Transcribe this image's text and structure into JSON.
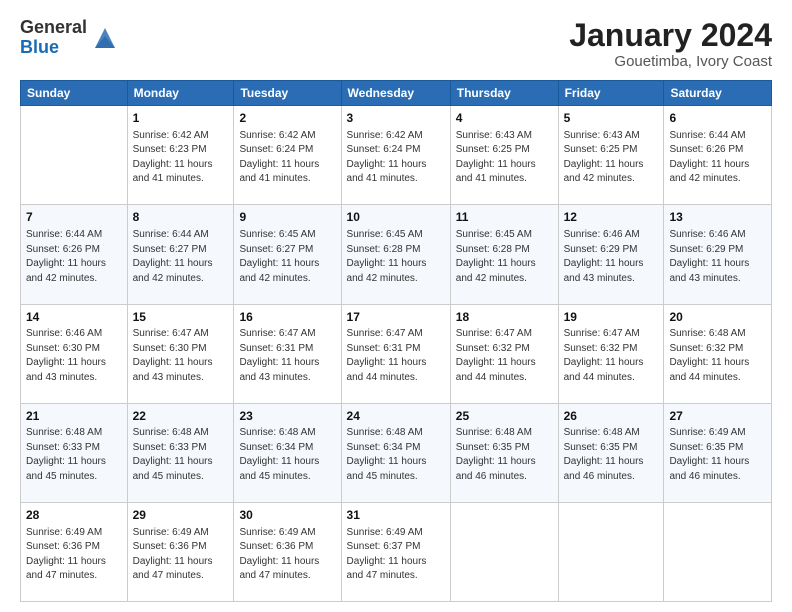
{
  "header": {
    "logo_general": "General",
    "logo_blue": "Blue",
    "title": "January 2024",
    "subtitle": "Gouetimba, Ivory Coast"
  },
  "days_of_week": [
    "Sunday",
    "Monday",
    "Tuesday",
    "Wednesday",
    "Thursday",
    "Friday",
    "Saturday"
  ],
  "weeks": [
    [
      {
        "day": "",
        "info": ""
      },
      {
        "day": "1",
        "info": "Sunrise: 6:42 AM\nSunset: 6:23 PM\nDaylight: 11 hours\nand 41 minutes."
      },
      {
        "day": "2",
        "info": "Sunrise: 6:42 AM\nSunset: 6:24 PM\nDaylight: 11 hours\nand 41 minutes."
      },
      {
        "day": "3",
        "info": "Sunrise: 6:42 AM\nSunset: 6:24 PM\nDaylight: 11 hours\nand 41 minutes."
      },
      {
        "day": "4",
        "info": "Sunrise: 6:43 AM\nSunset: 6:25 PM\nDaylight: 11 hours\nand 41 minutes."
      },
      {
        "day": "5",
        "info": "Sunrise: 6:43 AM\nSunset: 6:25 PM\nDaylight: 11 hours\nand 42 minutes."
      },
      {
        "day": "6",
        "info": "Sunrise: 6:44 AM\nSunset: 6:26 PM\nDaylight: 11 hours\nand 42 minutes."
      }
    ],
    [
      {
        "day": "7",
        "info": "Sunrise: 6:44 AM\nSunset: 6:26 PM\nDaylight: 11 hours\nand 42 minutes."
      },
      {
        "day": "8",
        "info": "Sunrise: 6:44 AM\nSunset: 6:27 PM\nDaylight: 11 hours\nand 42 minutes."
      },
      {
        "day": "9",
        "info": "Sunrise: 6:45 AM\nSunset: 6:27 PM\nDaylight: 11 hours\nand 42 minutes."
      },
      {
        "day": "10",
        "info": "Sunrise: 6:45 AM\nSunset: 6:28 PM\nDaylight: 11 hours\nand 42 minutes."
      },
      {
        "day": "11",
        "info": "Sunrise: 6:45 AM\nSunset: 6:28 PM\nDaylight: 11 hours\nand 42 minutes."
      },
      {
        "day": "12",
        "info": "Sunrise: 6:46 AM\nSunset: 6:29 PM\nDaylight: 11 hours\nand 43 minutes."
      },
      {
        "day": "13",
        "info": "Sunrise: 6:46 AM\nSunset: 6:29 PM\nDaylight: 11 hours\nand 43 minutes."
      }
    ],
    [
      {
        "day": "14",
        "info": "Sunrise: 6:46 AM\nSunset: 6:30 PM\nDaylight: 11 hours\nand 43 minutes."
      },
      {
        "day": "15",
        "info": "Sunrise: 6:47 AM\nSunset: 6:30 PM\nDaylight: 11 hours\nand 43 minutes."
      },
      {
        "day": "16",
        "info": "Sunrise: 6:47 AM\nSunset: 6:31 PM\nDaylight: 11 hours\nand 43 minutes."
      },
      {
        "day": "17",
        "info": "Sunrise: 6:47 AM\nSunset: 6:31 PM\nDaylight: 11 hours\nand 44 minutes."
      },
      {
        "day": "18",
        "info": "Sunrise: 6:47 AM\nSunset: 6:32 PM\nDaylight: 11 hours\nand 44 minutes."
      },
      {
        "day": "19",
        "info": "Sunrise: 6:47 AM\nSunset: 6:32 PM\nDaylight: 11 hours\nand 44 minutes."
      },
      {
        "day": "20",
        "info": "Sunrise: 6:48 AM\nSunset: 6:32 PM\nDaylight: 11 hours\nand 44 minutes."
      }
    ],
    [
      {
        "day": "21",
        "info": "Sunrise: 6:48 AM\nSunset: 6:33 PM\nDaylight: 11 hours\nand 45 minutes."
      },
      {
        "day": "22",
        "info": "Sunrise: 6:48 AM\nSunset: 6:33 PM\nDaylight: 11 hours\nand 45 minutes."
      },
      {
        "day": "23",
        "info": "Sunrise: 6:48 AM\nSunset: 6:34 PM\nDaylight: 11 hours\nand 45 minutes."
      },
      {
        "day": "24",
        "info": "Sunrise: 6:48 AM\nSunset: 6:34 PM\nDaylight: 11 hours\nand 45 minutes."
      },
      {
        "day": "25",
        "info": "Sunrise: 6:48 AM\nSunset: 6:35 PM\nDaylight: 11 hours\nand 46 minutes."
      },
      {
        "day": "26",
        "info": "Sunrise: 6:48 AM\nSunset: 6:35 PM\nDaylight: 11 hours\nand 46 minutes."
      },
      {
        "day": "27",
        "info": "Sunrise: 6:49 AM\nSunset: 6:35 PM\nDaylight: 11 hours\nand 46 minutes."
      }
    ],
    [
      {
        "day": "28",
        "info": "Sunrise: 6:49 AM\nSunset: 6:36 PM\nDaylight: 11 hours\nand 47 minutes."
      },
      {
        "day": "29",
        "info": "Sunrise: 6:49 AM\nSunset: 6:36 PM\nDaylight: 11 hours\nand 47 minutes."
      },
      {
        "day": "30",
        "info": "Sunrise: 6:49 AM\nSunset: 6:36 PM\nDaylight: 11 hours\nand 47 minutes."
      },
      {
        "day": "31",
        "info": "Sunrise: 6:49 AM\nSunset: 6:37 PM\nDaylight: 11 hours\nand 47 minutes."
      },
      {
        "day": "",
        "info": ""
      },
      {
        "day": "",
        "info": ""
      },
      {
        "day": "",
        "info": ""
      }
    ]
  ]
}
